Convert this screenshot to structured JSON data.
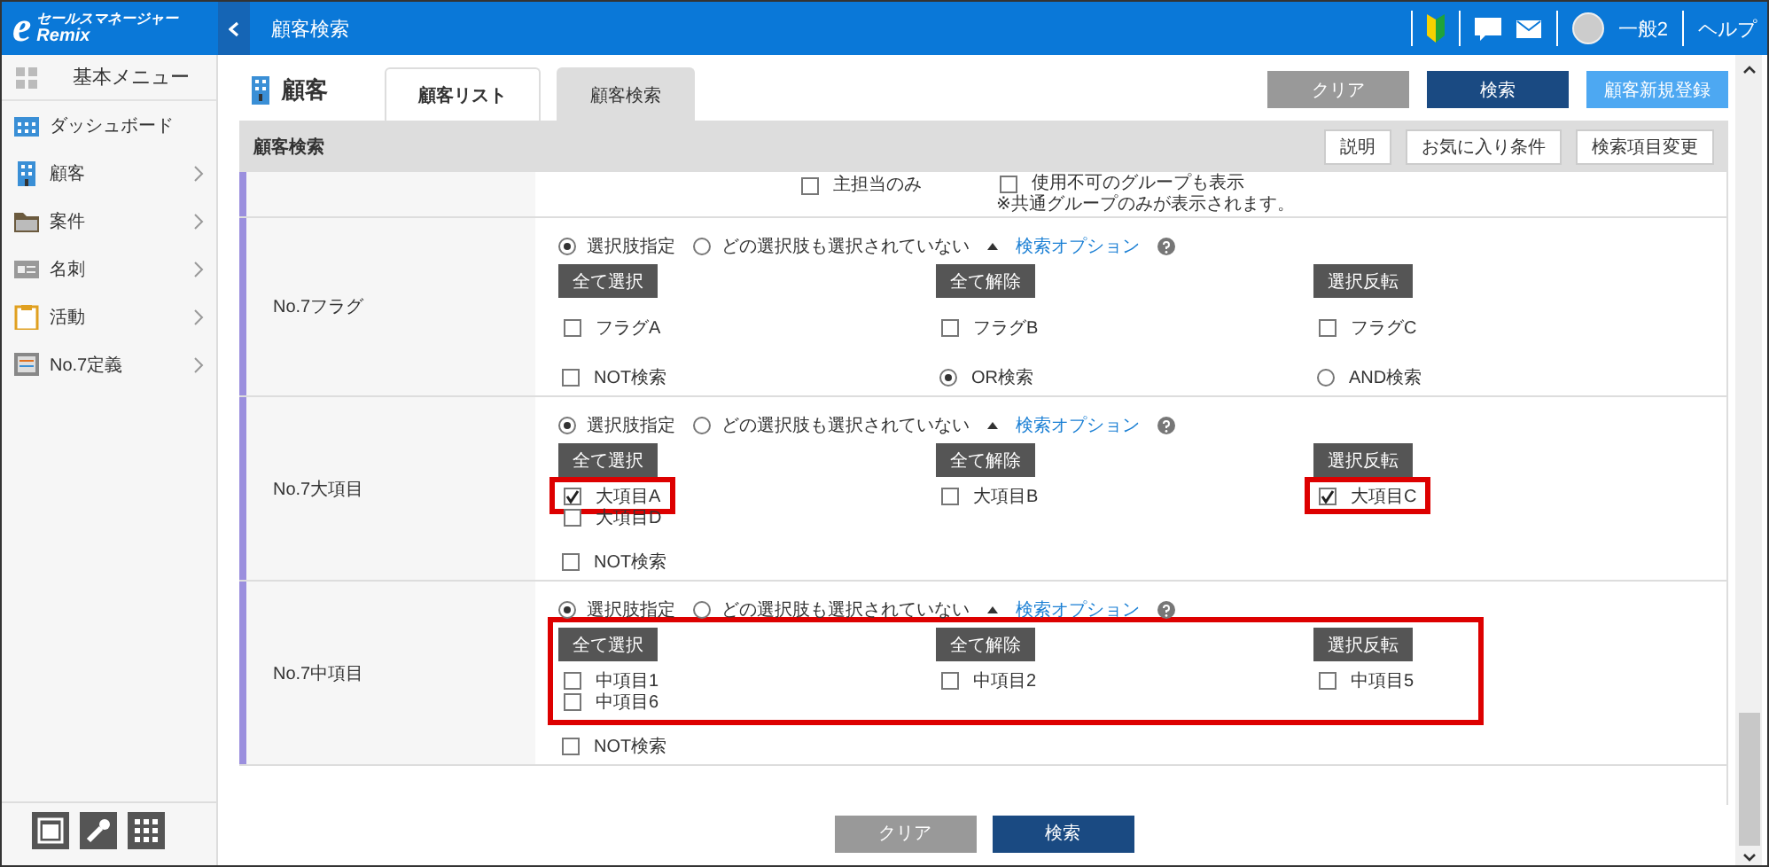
{
  "header": {
    "logo": {
      "mark": "e",
      "line_1": "セールスマネージャー",
      "line_2": "Remix"
    },
    "title": "顧客検索",
    "user": "一般2",
    "help": "ヘルプ"
  },
  "sidebar": {
    "heading": "基本メニュー",
    "items": [
      {
        "label": "ダッシュボード",
        "expandable": false
      },
      {
        "label": "顧客",
        "expandable": true
      },
      {
        "label": "案件",
        "expandable": true
      },
      {
        "label": "名刺",
        "expandable": true
      },
      {
        "label": "活動",
        "expandable": true
      },
      {
        "label": "No.7定義",
        "expandable": true
      }
    ]
  },
  "page": {
    "title": "顧客",
    "tabs": [
      {
        "label": "顧客リスト",
        "selected": false
      },
      {
        "label": "顧客検索",
        "selected": true
      }
    ],
    "actions": [
      {
        "label": "クリア",
        "kind": "clear"
      },
      {
        "label": "検索",
        "kind": "primary"
      },
      {
        "label": "顧客新規登録",
        "kind": "create"
      }
    ]
  },
  "panel": {
    "title": "顧客検索",
    "tools": [
      "説明",
      "お気に入り条件",
      "検索項目変更"
    ]
  },
  "partial_row": {
    "option": {
      "label": "主担当のみ",
      "checked": false
    },
    "group_option": {
      "label": "使用不可のグループも表示",
      "checked": false
    },
    "note": "※共通グループのみが表示されます。"
  },
  "fields": [
    {
      "label": "No.7フラグ",
      "modes": [
        {
          "label": "選択肢指定",
          "selected": true
        },
        {
          "label": "どの選択肢も選択されていない",
          "selected": false
        }
      ],
      "option_link": "検索オプション",
      "options_highlighted": false,
      "columns": [
        {
          "button": "全て選択",
          "options": [
            {
              "label": "フラグA",
              "checked": false,
              "highlighted": false
            }
          ]
        },
        {
          "button": "全て解除",
          "options": [
            {
              "label": "フラグB",
              "checked": false,
              "highlighted": false
            }
          ]
        },
        {
          "button": "選択反転",
          "options": [
            {
              "label": "フラグC",
              "checked": false,
              "highlighted": false
            }
          ]
        }
      ],
      "logic": [
        {
          "kind": "checkbox",
          "label": "NOT検索",
          "checked": false
        },
        {
          "kind": "radio",
          "label": "OR検索",
          "selected": true
        },
        {
          "kind": "radio",
          "label": "AND検索",
          "selected": false
        }
      ]
    },
    {
      "label": "No.7大項目",
      "modes": [
        {
          "label": "選択肢指定",
          "selected": true
        },
        {
          "label": "どの選択肢も選択されていない",
          "selected": false
        }
      ],
      "option_link": "検索オプション",
      "options_highlighted": false,
      "columns": [
        {
          "button": "全て選択",
          "options": [
            {
              "label": "大項目A",
              "checked": true,
              "highlighted": true
            },
            {
              "label": "大項目D",
              "checked": false,
              "highlighted": false
            }
          ]
        },
        {
          "button": "全て解除",
          "options": [
            {
              "label": "大項目B",
              "checked": false,
              "highlighted": false
            }
          ]
        },
        {
          "button": "選択反転",
          "options": [
            {
              "label": "大項目C",
              "checked": true,
              "highlighted": true
            }
          ]
        }
      ],
      "logic": [
        {
          "kind": "checkbox",
          "label": "NOT検索",
          "checked": false
        }
      ]
    },
    {
      "label": "No.7中項目",
      "modes": [
        {
          "label": "選択肢指定",
          "selected": true
        },
        {
          "label": "どの選択肢も選択されていない",
          "selected": false
        }
      ],
      "option_link": "検索オプション",
      "options_highlighted": true,
      "columns": [
        {
          "button": "全て選択",
          "options": [
            {
              "label": "中項目1",
              "checked": false,
              "highlighted": false
            },
            {
              "label": "中項目6",
              "checked": false,
              "highlighted": false
            }
          ]
        },
        {
          "button": "全て解除",
          "options": [
            {
              "label": "中項目2",
              "checked": false,
              "highlighted": false
            }
          ]
        },
        {
          "button": "選択反転",
          "options": [
            {
              "label": "中項目5",
              "checked": false,
              "highlighted": false
            }
          ]
        }
      ],
      "logic": [
        {
          "kind": "checkbox",
          "label": "NOT検索",
          "checked": false
        }
      ]
    }
  ],
  "footer": {
    "buttons": [
      {
        "label": "クリア",
        "kind": "clear"
      },
      {
        "label": "検索",
        "kind": "primary"
      }
    ]
  }
}
